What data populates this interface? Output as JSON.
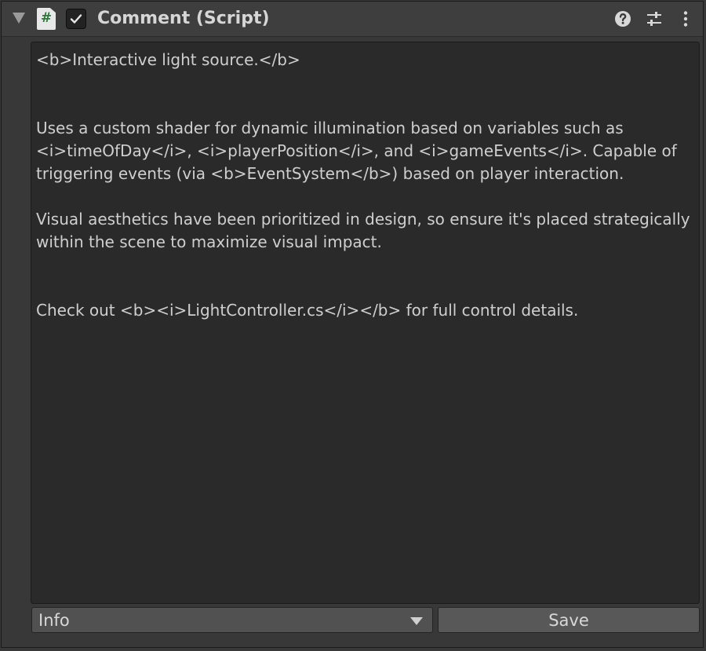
{
  "component": {
    "title": "Comment (Script)",
    "script_icon_glyph": "#",
    "enabled": true,
    "icons": {
      "fold": "foldout-triangle-icon",
      "script": "csharp-script-icon",
      "toggle": "checkmark-icon",
      "help": "help-icon",
      "presets": "presets-sliders-icon",
      "menu": "kebab-menu-icon"
    }
  },
  "comment_text": "<b>Interactive light source.</b>\n\n\nUses a custom shader for dynamic illumination based on variables such as <i>timeOfDay</i>, <i>playerPosition</i>, and <i>gameEvents</i>. Capable of triggering events (via <b>EventSystem</b>) based on player interaction.\n\nVisual aesthetics have been prioritized in design, so ensure it's placed strategically within the scene to maximize visual impact.\n\n\nCheck out <b><i>LightController.cs</i></b> for full control details.",
  "footer": {
    "type_dropdown_value": "Info",
    "save_label": "Save"
  },
  "colors": {
    "panel_bg": "#383838",
    "header_bg": "#3e3e3e",
    "textarea_bg": "#2a2a2a",
    "text": "#cfcfcf",
    "script_icon_hash": "#2a7a3a"
  }
}
